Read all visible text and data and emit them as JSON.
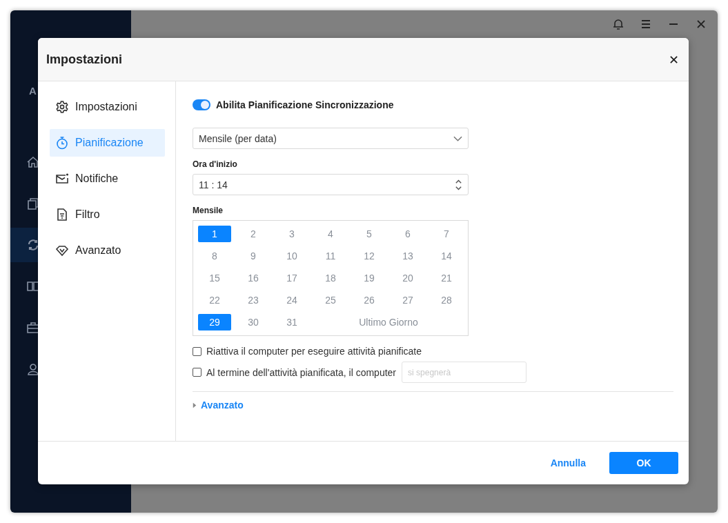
{
  "app_sidebar": {
    "logo_text": "A",
    "items": [
      {
        "kind": "home",
        "selected": false
      },
      {
        "kind": "copy",
        "selected": false
      },
      {
        "kind": "sync",
        "selected": true
      },
      {
        "kind": "columns",
        "selected": false
      },
      {
        "kind": "briefcase",
        "selected": false
      },
      {
        "kind": "user",
        "selected": false
      }
    ]
  },
  "dialog": {
    "title": "Impostazioni",
    "nav": [
      {
        "kind": "gear",
        "label": "Impostazioni",
        "selected": false
      },
      {
        "kind": "timer",
        "label": "Pianificazione",
        "selected": true
      },
      {
        "kind": "mail",
        "label": "Notifiche",
        "selected": false
      },
      {
        "kind": "file",
        "label": "Filtro",
        "selected": false
      },
      {
        "kind": "diamond",
        "label": "Avanzato",
        "selected": false
      }
    ],
    "toggle": {
      "label": "Abilita Pianificazione Sincronizzazione",
      "on": true
    },
    "schedule": {
      "value": "Mensile (per data)"
    },
    "start_time": {
      "label": "Ora d'inizio",
      "value": "11 : 14"
    },
    "monthly": {
      "label": "Mensile",
      "days": [
        {
          "label": "1",
          "selected": true
        },
        {
          "label": "2",
          "selected": false
        },
        {
          "label": "3",
          "selected": false
        },
        {
          "label": "4",
          "selected": false
        },
        {
          "label": "5",
          "selected": false
        },
        {
          "label": "6",
          "selected": false
        },
        {
          "label": "7",
          "selected": false
        },
        {
          "label": "8",
          "selected": false
        },
        {
          "label": "9",
          "selected": false
        },
        {
          "label": "10",
          "selected": false
        },
        {
          "label": "11",
          "selected": false
        },
        {
          "label": "12",
          "selected": false
        },
        {
          "label": "13",
          "selected": false
        },
        {
          "label": "14",
          "selected": false
        },
        {
          "label": "15",
          "selected": false
        },
        {
          "label": "16",
          "selected": false
        },
        {
          "label": "17",
          "selected": false
        },
        {
          "label": "18",
          "selected": false
        },
        {
          "label": "19",
          "selected": false
        },
        {
          "label": "20",
          "selected": false
        },
        {
          "label": "21",
          "selected": false
        },
        {
          "label": "22",
          "selected": false
        },
        {
          "label": "23",
          "selected": false
        },
        {
          "label": "24",
          "selected": false
        },
        {
          "label": "25",
          "selected": false
        },
        {
          "label": "26",
          "selected": false
        },
        {
          "label": "27",
          "selected": false
        },
        {
          "label": "28",
          "selected": false
        },
        {
          "label": "29",
          "selected": true
        },
        {
          "label": "30",
          "selected": false
        },
        {
          "label": "31",
          "selected": false
        },
        {
          "label": "Ultimo Giorno",
          "selected": false,
          "kind": "last"
        }
      ]
    },
    "options": [
      {
        "label": "Riattiva il computer per eseguire attività pianificate",
        "checked": false
      },
      {
        "label": "Al termine dell'attività pianificata, il computer",
        "checked": false,
        "placeholder": "si spegnerà"
      }
    ],
    "advanced": {
      "label": "Avanzato",
      "expanded": false
    },
    "buttons": {
      "cancel": "Annulla",
      "ok": "OK"
    }
  }
}
